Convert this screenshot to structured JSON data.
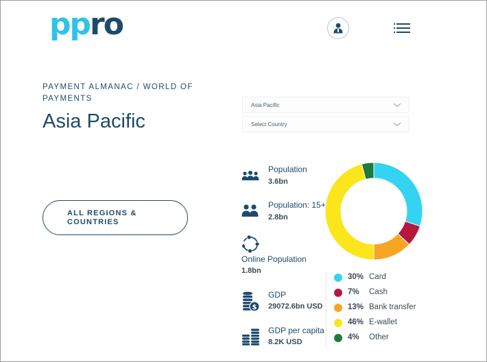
{
  "header": {
    "logo_part1": "pp",
    "logo_part2": "ro",
    "account_icon": "account-icon",
    "menu_icon": "hamburger-menu-icon"
  },
  "breadcrumb": "PAYMENT ALMANAC / WORLD OF PAYMENTS",
  "page_title": "Asia Pacific",
  "region_select": {
    "value": "Asia Pacific"
  },
  "country_select": {
    "placeholder": "Select Country"
  },
  "regions_button": {
    "label_line1": "ALL REGIONS &",
    "label_line2": "COUNTRIES"
  },
  "stats": {
    "population": {
      "label": "Population",
      "value": "3.6bn",
      "icon": "people-group-icon"
    },
    "population_15": {
      "label": "Population: 15+",
      "value": "2.8bn",
      "icon": "adults-icon"
    },
    "online_population": {
      "label": "Online Population",
      "value": "1.8bn",
      "icon": "network-icon"
    },
    "gdp": {
      "label": "GDP",
      "value": "29072.6bn USD",
      "icon": "coin-stack-dollar-icon"
    },
    "gdp_per_capita": {
      "label": "GDP per capita",
      "value": "8.2K USD",
      "icon": "coin-stacks-icon"
    }
  },
  "chart_data": {
    "type": "pie",
    "categories": [
      "Card",
      "Cash",
      "Bank transfer",
      "E-wallet",
      "Other"
    ],
    "values": [
      30,
      7,
      13,
      46,
      4
    ],
    "labels": [
      "30%",
      "7%",
      "13%",
      "46%",
      "4%"
    ],
    "colors": [
      "#34d3f0",
      "#b5173f",
      "#f6a623",
      "#fbe51b",
      "#1f7a3c"
    ],
    "legend": "bottom"
  }
}
